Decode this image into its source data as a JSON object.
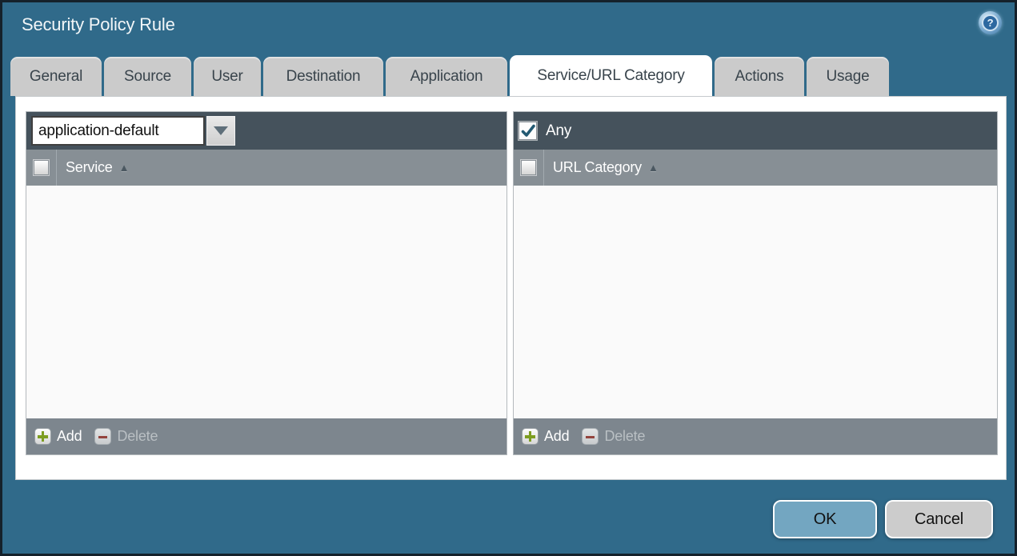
{
  "window": {
    "title": "Security Policy Rule"
  },
  "icons": {
    "help_glyph": "?",
    "sort_asc_glyph": "▲"
  },
  "tabs": [
    {
      "label": "General",
      "active": false
    },
    {
      "label": "Source",
      "active": false
    },
    {
      "label": "User",
      "active": false
    },
    {
      "label": "Destination",
      "active": false
    },
    {
      "label": "Application",
      "active": false
    },
    {
      "label": "Service/URL Category",
      "active": true
    },
    {
      "label": "Actions",
      "active": false
    },
    {
      "label": "Usage",
      "active": false
    }
  ],
  "panels": {
    "service": {
      "dropdown": {
        "value": "application-default"
      },
      "column_header": "Service",
      "column_checkbox_checked": false,
      "rows": [],
      "footer": {
        "add": "Add",
        "delete": "Delete",
        "delete_enabled": false
      }
    },
    "url_category": {
      "any": {
        "label": "Any",
        "checked": true
      },
      "column_header": "URL Category",
      "column_checkbox_checked": false,
      "rows": [],
      "footer": {
        "add": "Add",
        "delete": "Delete",
        "delete_enabled": false
      }
    }
  },
  "buttons": {
    "ok": "OK",
    "cancel": "Cancel"
  },
  "colors": {
    "dialog_background": "#306a8a",
    "window_border": "#15212b",
    "panel_header": "#45525c",
    "column_header": "#878f95",
    "footer_bar": "#7d868e",
    "tab_inactive": "#cbcbcb",
    "tab_active": "#ffffff",
    "ok_button": "#73a6c1",
    "cancel_button": "#cccccc",
    "add_icon_green": "#7d9d21",
    "delete_icon_red": "#94443d",
    "checkmark_blue": "#235a73"
  }
}
